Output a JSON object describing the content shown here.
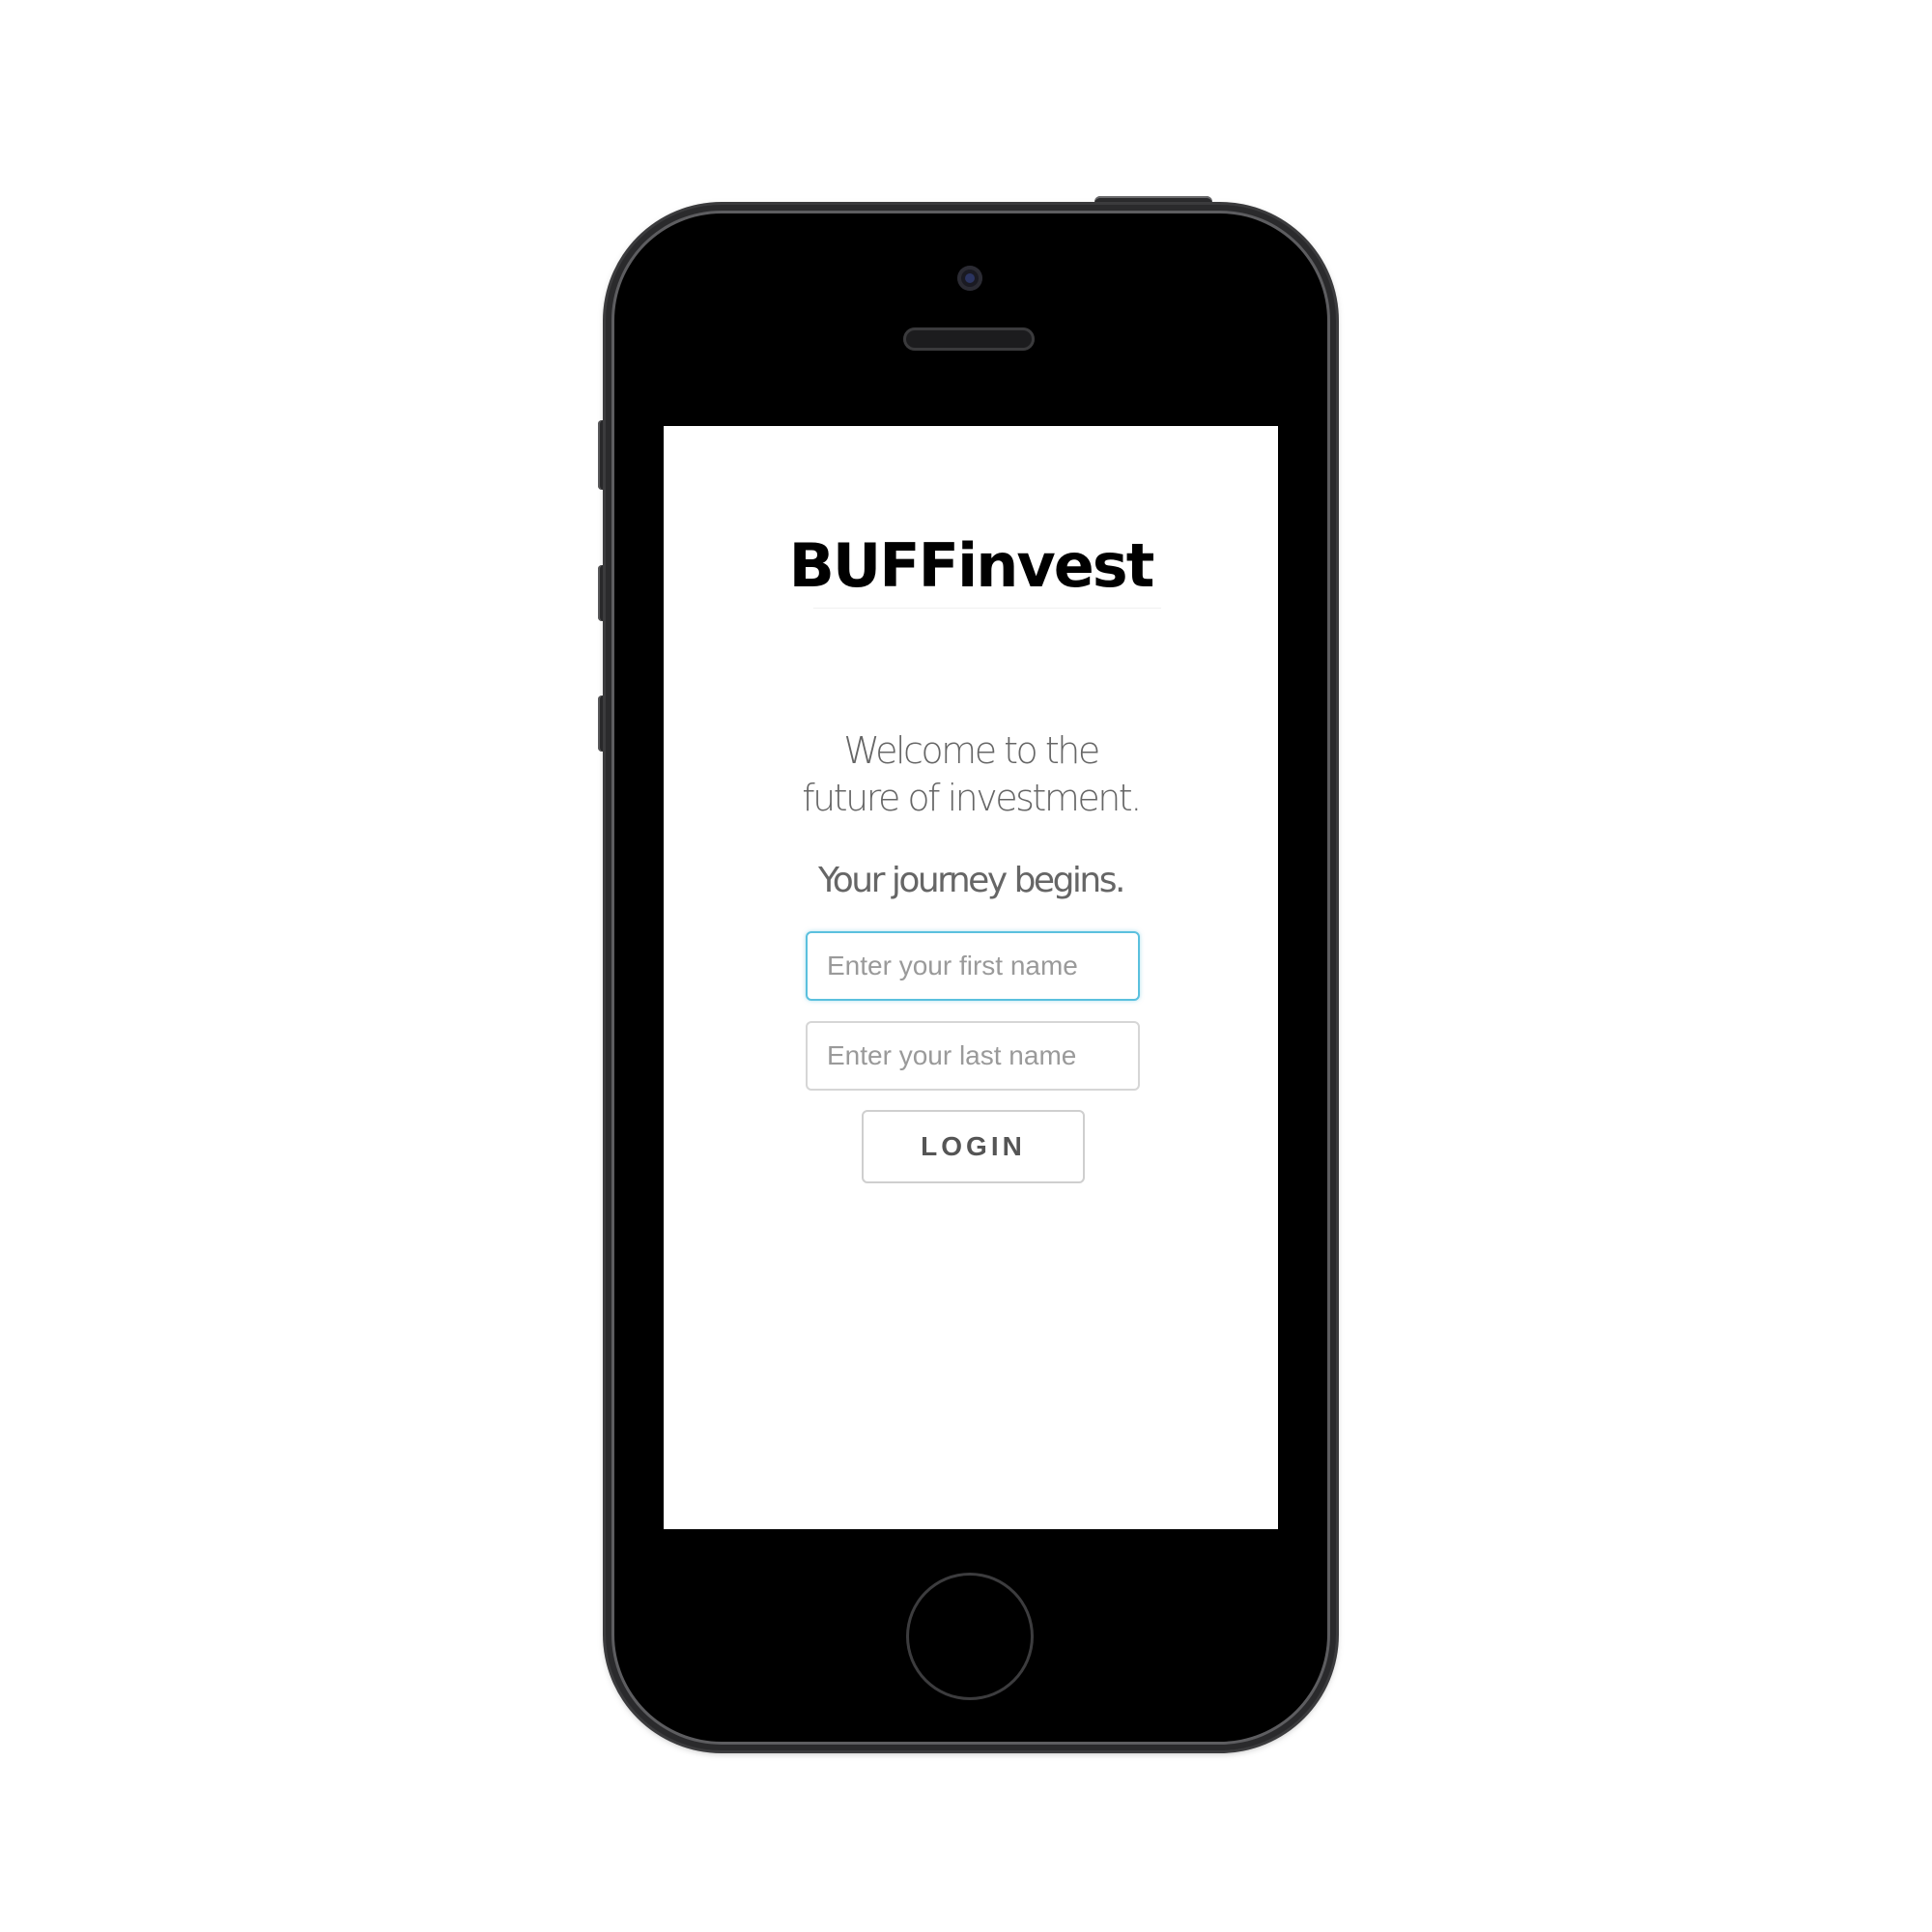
{
  "app": {
    "brand": "BUFFinvest"
  },
  "welcome": {
    "line1": "Welcome to the",
    "line2": "future of investment.",
    "tagline": "Your journey begins."
  },
  "form": {
    "first_name_placeholder": "Enter your first name",
    "first_name_value": "",
    "last_name_placeholder": "Enter your last name",
    "last_name_value": "",
    "login_label": "LOGIN"
  },
  "colors": {
    "focus_ring": "#5bc0de",
    "text_muted": "#666666",
    "brand_text": "#000000"
  }
}
